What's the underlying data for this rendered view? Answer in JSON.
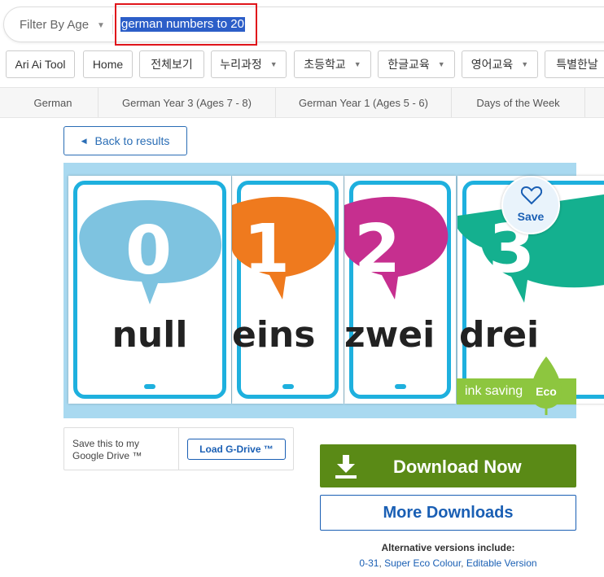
{
  "search": {
    "filter_label": "Filter By Age",
    "query": "german numbers to 20"
  },
  "categories": [
    {
      "label": "Ari Ai Tool",
      "dropdown": false
    },
    {
      "label": "Home",
      "dropdown": false
    },
    {
      "label": "전체보기",
      "dropdown": false
    },
    {
      "label": "누리과정",
      "dropdown": true
    },
    {
      "label": "초등학교",
      "dropdown": true
    },
    {
      "label": "한글교육",
      "dropdown": true
    },
    {
      "label": "영어교육",
      "dropdown": true
    },
    {
      "label": "특별한날",
      "dropdown": false
    }
  ],
  "tags": [
    "German",
    "German Year 3 (Ages 7 - 8)",
    "German Year 1 (Ages 5 - 6)",
    "Days of the Week"
  ],
  "back_label": "Back to results",
  "preview": {
    "cards": [
      {
        "digit": "0",
        "word": "null",
        "bubble_color": "#7ec3e0"
      },
      {
        "digit": "1",
        "word": "eins",
        "bubble_color": "#ef7a1e"
      },
      {
        "digit": "2",
        "word": "zwei",
        "bubble_color": "#c62f8f"
      },
      {
        "digit": "3",
        "word": "drei",
        "bubble_color": "#14b08f"
      }
    ],
    "save_label": "Save",
    "eco_label": "ink saving",
    "eco_badge": "Eco"
  },
  "gdrive": {
    "text": "Save this to my Google Drive ™",
    "button": "Load G-Drive ™"
  },
  "download": {
    "button": "Download Now",
    "more": "More Downloads",
    "alt_title": "Alternative versions include:",
    "alt_links": [
      "0-31",
      "Super Eco Colour",
      "Editable Version"
    ]
  },
  "colors": {
    "accent_blue": "#1a5fb4",
    "download_green": "#5a8a16",
    "highlight_red": "#e0151b",
    "preview_bg": "#a9d9f0",
    "eco_green": "#8dc63f"
  }
}
